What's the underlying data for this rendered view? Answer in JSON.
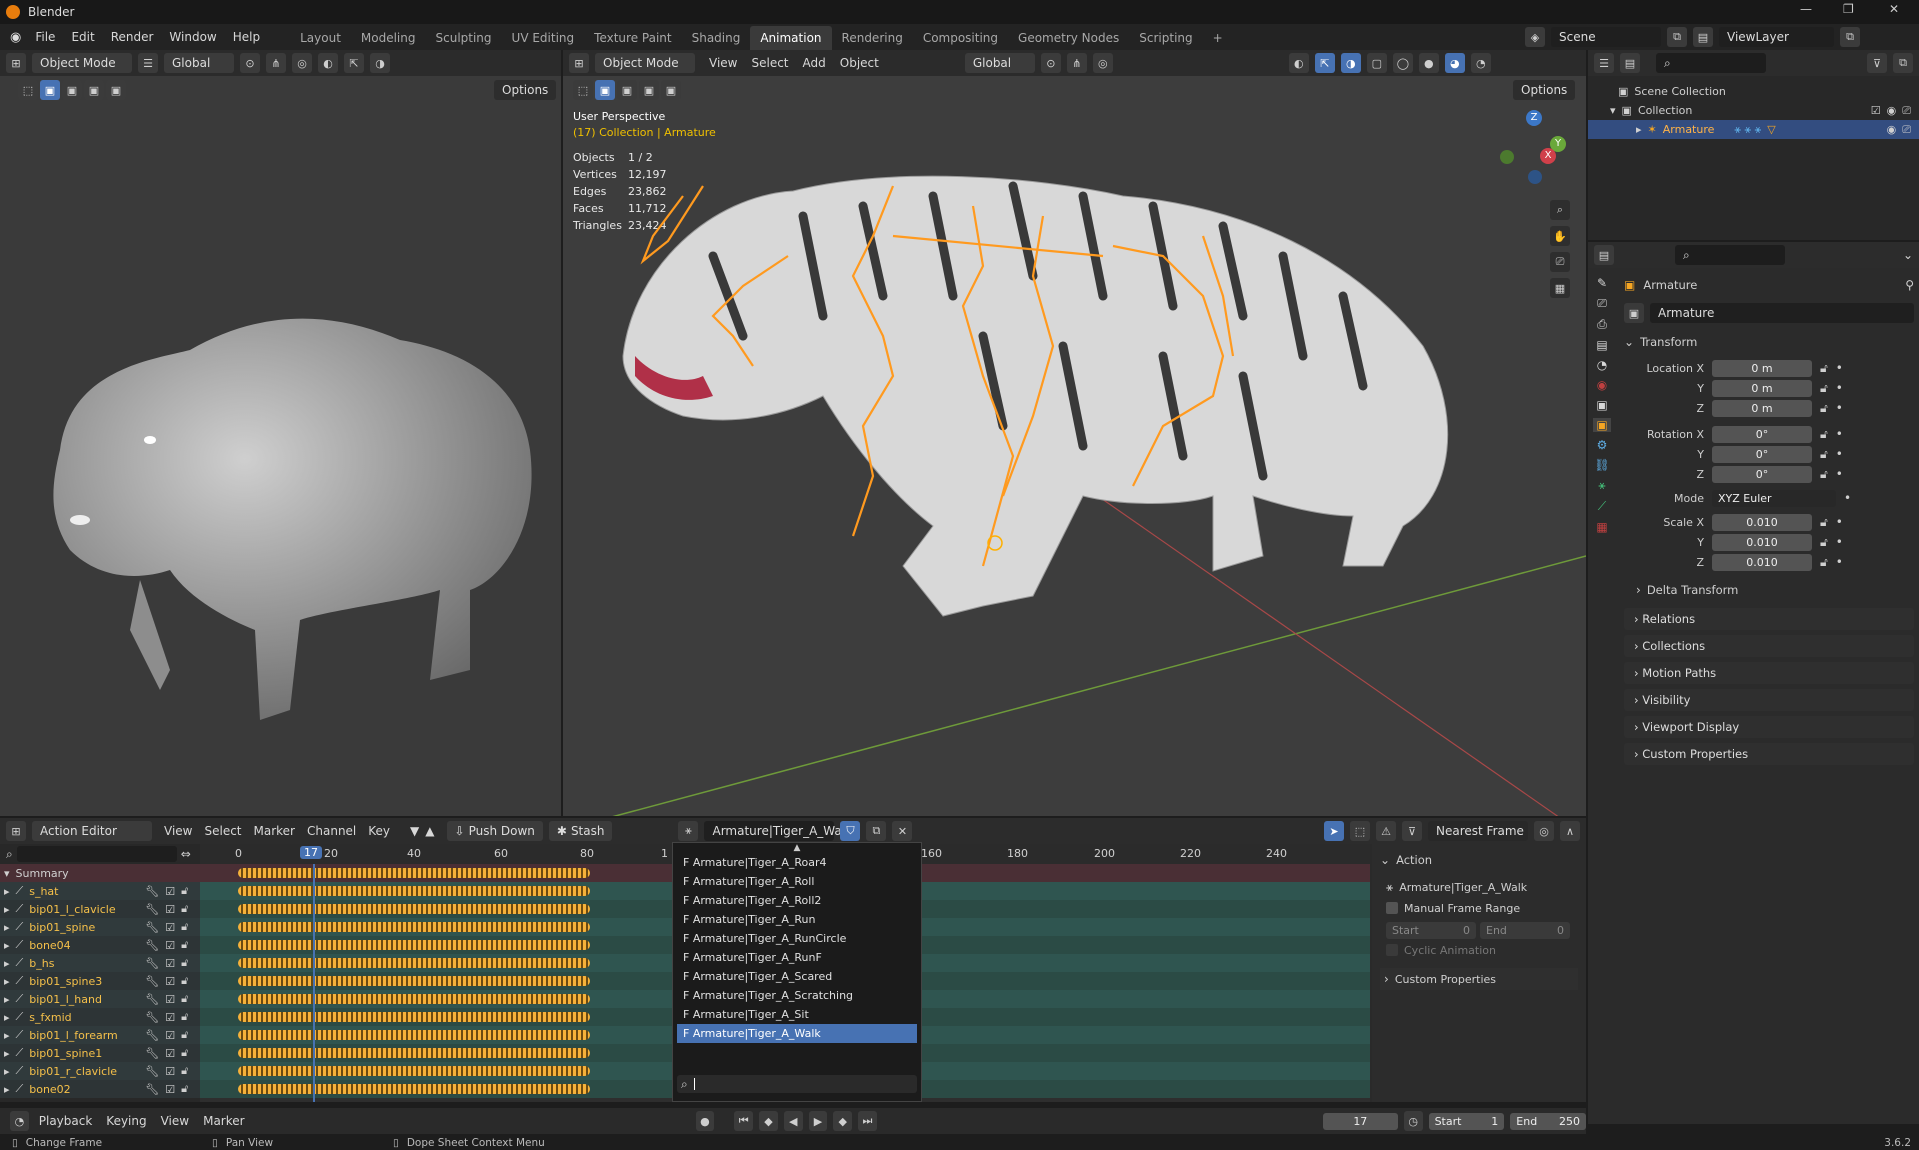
{
  "app": {
    "title": "Blender",
    "logo": "blender-logo-icon"
  },
  "menu": [
    "File",
    "Edit",
    "Render",
    "Window",
    "Help"
  ],
  "workspaces": [
    {
      "label": "Layout"
    },
    {
      "label": "Modeling"
    },
    {
      "label": "Sculpting"
    },
    {
      "label": "UV Editing"
    },
    {
      "label": "Texture Paint"
    },
    {
      "label": "Shading"
    },
    {
      "label": "Animation",
      "active": true
    },
    {
      "label": "Rendering"
    },
    {
      "label": "Compositing"
    },
    {
      "label": "Geometry Nodes"
    },
    {
      "label": "Scripting"
    }
  ],
  "scene": {
    "name": "Scene",
    "view_layer": "ViewLayer"
  },
  "left_viewport": {
    "mode": "Object Mode",
    "orientation": "Global",
    "options": "Options"
  },
  "main_viewport": {
    "mode": "Object Mode",
    "menus": [
      "View",
      "Select",
      "Add",
      "Object"
    ],
    "orientation": "Global",
    "options": "Options",
    "view_name": "User Perspective",
    "collection": "(17) Collection | Armature",
    "stats": [
      {
        "label": "Objects",
        "value": "1 / 2"
      },
      {
        "label": "Vertices",
        "value": "12,197"
      },
      {
        "label": "Edges",
        "value": "23,862"
      },
      {
        "label": "Faces",
        "value": "11,712"
      },
      {
        "label": "Triangles",
        "value": "23,424"
      }
    ],
    "gizmo": {
      "x": "X",
      "y": "Y",
      "z": "Z"
    }
  },
  "outliner": {
    "scene_collection": "Scene Collection",
    "collection": "Collection",
    "armature": "Armature"
  },
  "properties": {
    "header": "Armature",
    "object_name": "Armature",
    "transform": "Transform",
    "location": {
      "label": "Location X",
      "x": "0 m",
      "y": "0 m",
      "z": "0 m"
    },
    "rotation": {
      "label": "Rotation X",
      "x": "0°",
      "y": "0°",
      "z": "0°"
    },
    "mode": {
      "label": "Mode",
      "value": "XYZ Euler"
    },
    "scale": {
      "label": "Scale X",
      "x": "0.010",
      "y": "0.010",
      "z": "0.010"
    },
    "axis_y": "Y",
    "axis_z": "Z",
    "delta": "Delta Transform",
    "sections": [
      "Relations",
      "Collections",
      "Motion Paths",
      "Visibility",
      "Viewport Display",
      "Custom Properties"
    ]
  },
  "action_editor": {
    "editor": "Action Editor",
    "menus": [
      "View",
      "Select",
      "Marker",
      "Channel",
      "Key"
    ],
    "push_down": "Push Down",
    "stash": "Stash",
    "action": "Armature|Tiger_A_Walk",
    "snap": "Nearest Frame",
    "current_frame": "17",
    "ticks": [
      "0",
      "20",
      "40",
      "60",
      "80",
      "1",
      "160",
      "180",
      "200",
      "220",
      "240"
    ],
    "summary": "Summary",
    "channels": [
      "s_hat",
      "bip01_l_clavicle",
      "bip01_spine",
      "bone04",
      "b_hs",
      "bip01_spine3",
      "bip01_l_hand",
      "s_fxmid",
      "bip01_l_forearm",
      "bip01_spine1",
      "bip01_r_clavicle",
      "bone02"
    ],
    "actions": [
      "F Armature|Tiger_A_Roar4",
      "F Armature|Tiger_A_Roll",
      "F Armature|Tiger_A_Roll2",
      "F Armature|Tiger_A_Run",
      "F Armature|Tiger_A_RunCircle",
      "F Armature|Tiger_A_RunF",
      "F Armature|Tiger_A_Scared",
      "F Armature|Tiger_A_Scratching",
      "F Armature|Tiger_A_Sit",
      "F Armature|Tiger_A_Walk"
    ],
    "side": {
      "title": "Action",
      "action_name": "Armature|Tiger_A_Walk",
      "manual": "Manual Frame Range",
      "start_label": "Start",
      "start": "0",
      "end_label": "End",
      "end": "0",
      "cyclic": "Cyclic Animation",
      "custom": "Custom Properties"
    }
  },
  "timeline": {
    "menus": [
      "Playback",
      "Keying",
      "View",
      "Marker"
    ],
    "frame": "17",
    "start_label": "Start",
    "start": "1",
    "end_label": "End",
    "end": "250"
  },
  "statusbar": {
    "items": [
      "Change Frame",
      "Pan View",
      "Dope Sheet Context Menu"
    ],
    "version": "3.6.2"
  }
}
